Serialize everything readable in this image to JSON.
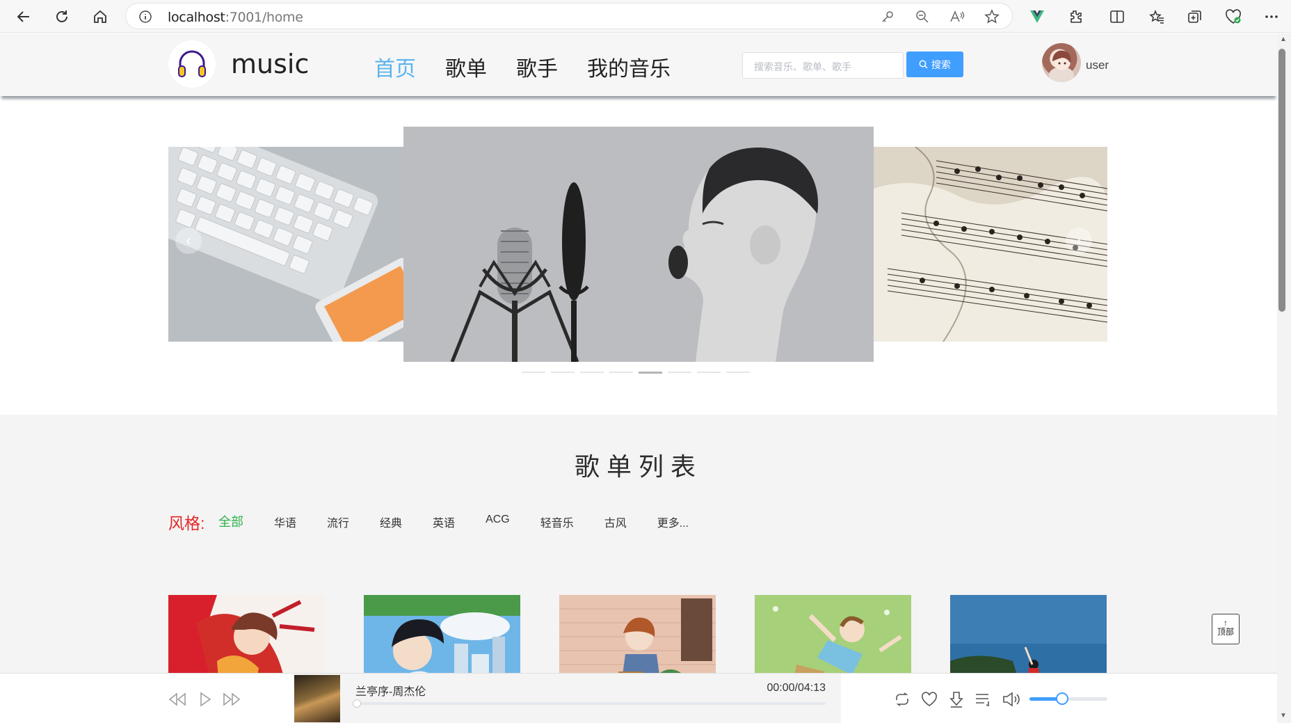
{
  "browser": {
    "url_host": "localhost",
    "url_rest": ":7001/home"
  },
  "header": {
    "logo_text": "music",
    "nav": [
      {
        "label": "首页",
        "active": true
      },
      {
        "label": "歌单",
        "active": false
      },
      {
        "label": "歌手",
        "active": false
      },
      {
        "label": "我的音乐",
        "active": false
      }
    ],
    "search_placeholder": "搜索音乐、歌单、歌手",
    "search_button": "搜索",
    "user_name": "user"
  },
  "carousel": {
    "slides": [
      "keyboard-and-phone-photo",
      "boy-singing-into-microphone-photo",
      "sheet-music-photo"
    ],
    "indicator_count": 8,
    "active_indicator": 5
  },
  "playlists": {
    "title": "歌单列表",
    "style_label": "风格:",
    "styles": [
      "全部",
      "华语",
      "流行",
      "经典",
      "英语",
      "ACG",
      "轻音乐",
      "古风",
      "更多..."
    ],
    "active_style": 0,
    "cards": [
      "anime-couple-red-scarf",
      "anime-boy-city-sky",
      "anime-girl-brick-wall",
      "anime-boy-lying-on-grass",
      "girl-on-cliff-by-sea"
    ]
  },
  "back_to_top": {
    "arrow": "↑",
    "label": "顶部"
  },
  "player": {
    "song": "兰亭序-周杰伦",
    "time": "00:00/04:13",
    "progress": 0,
    "volume": 0.42
  }
}
